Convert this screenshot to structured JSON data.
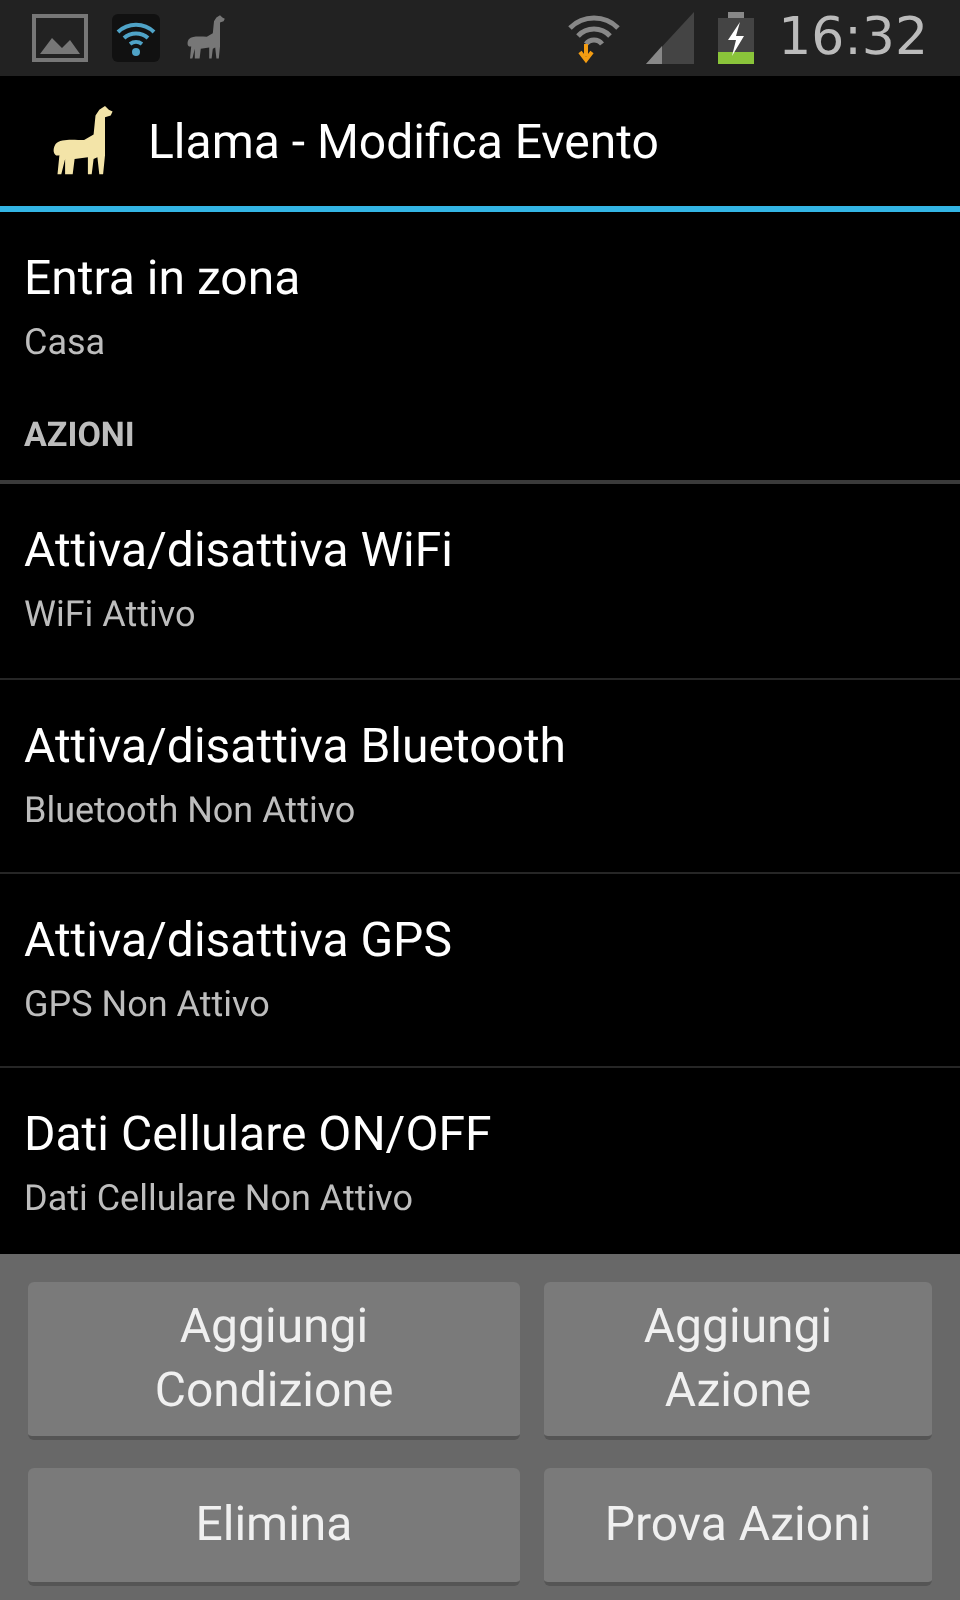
{
  "status_bar": {
    "time": "16:32"
  },
  "action_bar": {
    "title": "Llama - Modifica Evento"
  },
  "condition": {
    "title": "Entra in zona",
    "subtitle": "Casa"
  },
  "section_header": "AZIONI",
  "actions": [
    {
      "title": "Attiva/disattiva WiFi",
      "subtitle": "WiFi Attivo"
    },
    {
      "title": "Attiva/disattiva Bluetooth",
      "subtitle": "Bluetooth Non Attivo"
    },
    {
      "title": "Attiva/disattiva GPS",
      "subtitle": "GPS Non Attivo"
    },
    {
      "title": "Dati Cellulare ON/OFF",
      "subtitle": "Dati Cellulare Non Attivo"
    }
  ],
  "buttons": [
    {
      "lines": [
        "Aggiungi",
        "Condizione"
      ]
    },
    {
      "lines": [
        "Aggiungi",
        "Azione"
      ]
    },
    {
      "lines": [
        "Elimina"
      ]
    },
    {
      "lines": [
        "Prova Azioni"
      ]
    }
  ]
}
